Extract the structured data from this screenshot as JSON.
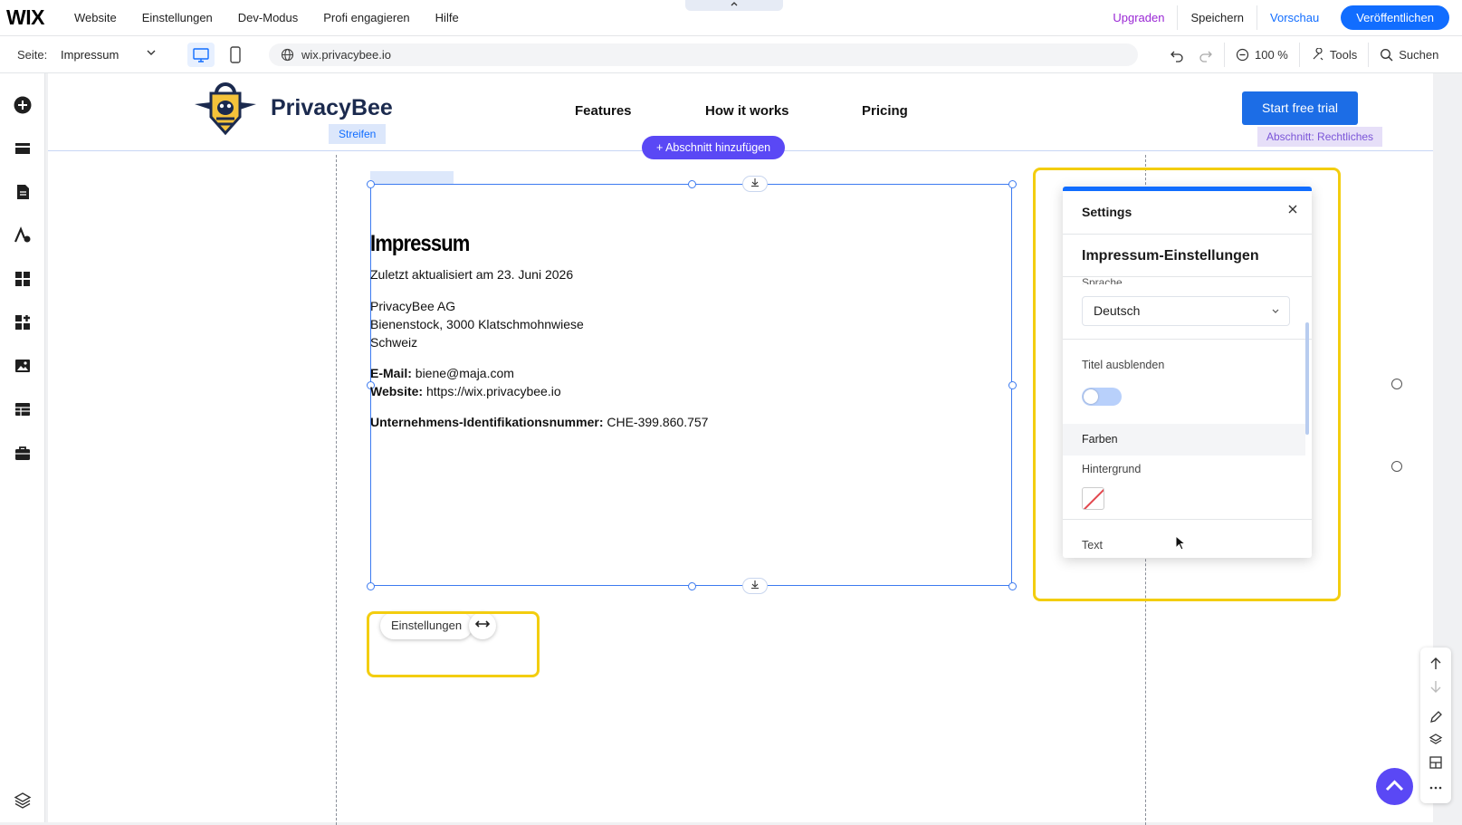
{
  "topbar": {
    "logo": "WIX",
    "menu": [
      "Website",
      "Einstellungen",
      "Dev-Modus",
      "Profi engagieren",
      "Hilfe"
    ],
    "upgrade": "Upgraden",
    "save": "Speichern",
    "preview": "Vorschau",
    "publish": "Veröffentlichen"
  },
  "subbar": {
    "page_label": "Seite:",
    "page_value": "Impressum",
    "url": "wix.privacybee.io",
    "zoom": "100 %",
    "tools": "Tools",
    "search": "Suchen"
  },
  "site": {
    "brand": "PrivacyBee",
    "nav": [
      "Features",
      "How it works",
      "Pricing"
    ],
    "cta": "Start free trial"
  },
  "editor": {
    "strip_tag": "Streifen",
    "add_section": "+ Abschnitt hinzufügen",
    "section_tag": "Abschnitt: Rechtliches",
    "float_settings": "Einstellungen"
  },
  "impressum": {
    "title": "Impressum",
    "updated": "Zuletzt aktualisiert am 23. Juni 2026",
    "company": "PrivacyBee AG",
    "street": "Bienenstock, 3000 Klatschmohnwiese",
    "country": "Schweiz",
    "email_label": "E-Mail:",
    "email_value": "biene@maja.com",
    "website_label": "Website:",
    "website_value": "https://wix.privacybee.io",
    "uid_label": "Unternehmens-Identifikationsnummer:",
    "uid_value": "CHE-399.860.757"
  },
  "settings_panel": {
    "title": "Settings",
    "subtitle": "Impressum-Einstellungen",
    "language_label": "Sprache",
    "language_value": "Deutsch",
    "hide_title_label": "Titel ausblenden",
    "hide_title_on": false,
    "colors_section": "Farben",
    "background_label": "Hintergrund",
    "text_label": "Text"
  },
  "colors": {
    "accent": "#116dff",
    "highlight": "#f3cd0f",
    "section_purple": "#5a48f5"
  }
}
